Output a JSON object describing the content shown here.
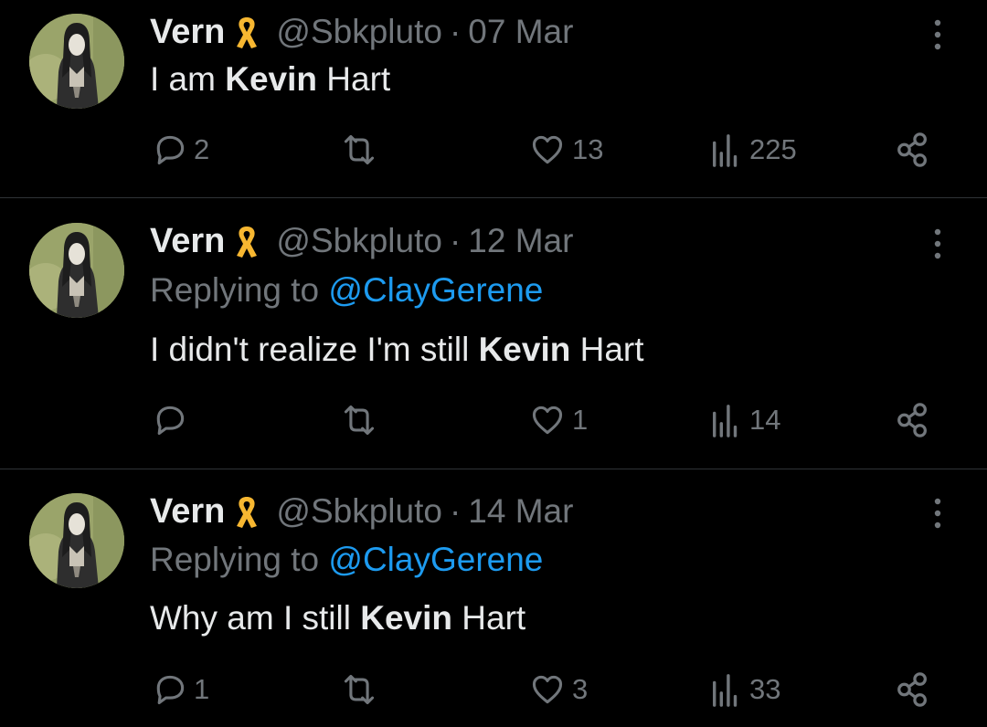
{
  "colors": {
    "background": "#000000",
    "text": "#e7e9ea",
    "muted": "#71767b",
    "link": "#1d9bf0",
    "ribbon": "#f7b731"
  },
  "tweets": [
    {
      "name": "Vern",
      "handle": "@Sbkpluto",
      "separator": "·",
      "date": "07 Mar",
      "replying_prefix": "",
      "replying_to": "",
      "text_before": "I am ",
      "text_bold": "Kevin",
      "text_after": " Hart",
      "replies": "2",
      "reposts": "",
      "likes": "13",
      "views": "225"
    },
    {
      "name": "Vern",
      "handle": "@Sbkpluto",
      "separator": "·",
      "date": "12 Mar",
      "replying_prefix": "Replying to ",
      "replying_to": "@ClayGerene",
      "text_before": "I didn't realize I'm still ",
      "text_bold": "Kevin",
      "text_after": " Hart",
      "replies": "",
      "reposts": "",
      "likes": "1",
      "views": "14"
    },
    {
      "name": "Vern",
      "handle": "@Sbkpluto",
      "separator": "·",
      "date": "14 Mar",
      "replying_prefix": "Replying to ",
      "replying_to": "@ClayGerene",
      "text_before": "Why am I still ",
      "text_bold": "Kevin",
      "text_after": " Hart",
      "replies": "1",
      "reposts": "",
      "likes": "3",
      "views": "33"
    }
  ],
  "icons": [
    "ribbon-icon",
    "more-icon",
    "reply-icon",
    "repost-icon",
    "like-icon",
    "views-icon",
    "share-icon"
  ]
}
